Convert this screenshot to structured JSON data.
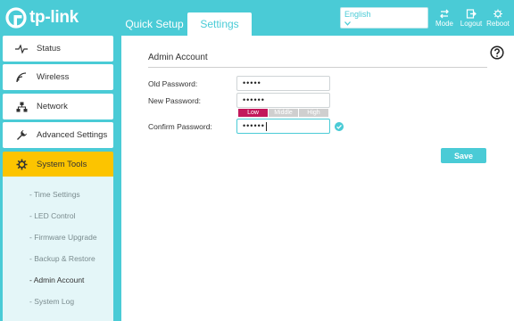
{
  "brand": {
    "logo_text": "tp-link",
    "accent": "#4acbd6",
    "active": "#fcc400"
  },
  "tabs": {
    "quick_setup": "Quick Setup",
    "settings": "Settings"
  },
  "language": {
    "selected": "English"
  },
  "header_buttons": {
    "mode": "Mode",
    "logout": "Logout",
    "reboot": "Reboot"
  },
  "sidebar": {
    "items": [
      {
        "label": "Status",
        "icon": "pulse-icon"
      },
      {
        "label": "Wireless",
        "icon": "wifi-icon"
      },
      {
        "label": "Network",
        "icon": "network-icon"
      },
      {
        "label": "Advanced Settings",
        "icon": "wrench-icon"
      },
      {
        "label": "System Tools",
        "icon": "gear-icon"
      }
    ],
    "submenu": [
      "- Time Settings",
      "- LED Control",
      "- Firmware Upgrade",
      "- Backup & Restore",
      "- Admin Account",
      "- System Log"
    ]
  },
  "main": {
    "section_title": "Admin Account",
    "old_password_label": "Old Password:",
    "old_password_value": "•••••",
    "new_password_label": "New Password:",
    "new_password_value": "••••••",
    "confirm_password_label": "Confirm Password:",
    "confirm_password_value": "••••••",
    "strength": {
      "low": "Low",
      "middle": "Middle",
      "high": "High",
      "level": "Low"
    },
    "save_label": "Save"
  }
}
